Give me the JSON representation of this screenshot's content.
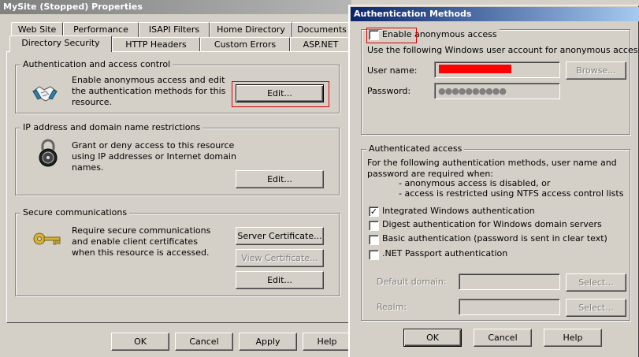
{
  "properties_window": {
    "title": "MySite (Stopped) Properties",
    "tabs_back": [
      "Web Site",
      "Performance",
      "ISAPI Filters",
      "Home Directory",
      "Documents"
    ],
    "tabs_front": [
      "Directory Security",
      "HTTP Headers",
      "Custom Errors",
      "ASP.NET"
    ],
    "active_tab": "Directory Security",
    "auth_group": {
      "label": "Authentication and access control",
      "text": "Enable anonymous access and edit the authentication methods for this resource.",
      "edit_label": "Edit..."
    },
    "ip_group": {
      "label": "IP address and domain name restrictions",
      "text": "Grant or deny access to this resource using IP addresses or Internet domain names.",
      "edit_label": "Edit..."
    },
    "secure_group": {
      "label": "Secure communications",
      "text": "Require secure communications and enable client certificates when this resource is accessed.",
      "server_cert_label": "Server Certificate...",
      "view_cert_label": "View Certificate...",
      "edit_label": "Edit..."
    },
    "buttons": {
      "ok": "OK",
      "cancel": "Cancel",
      "apply": "Apply",
      "help": "Help"
    }
  },
  "auth_dialog": {
    "title": "Authentication Methods",
    "anon_checkbox_label": "Enable anonymous access",
    "anon_checked": false,
    "anon_intro": "Use the following Windows user account for anonymous access:",
    "username_label": "User name:",
    "username_value": "",
    "browse_label": "Browse...",
    "password_label": "Password:",
    "password_value": "●●●●●●●●●●",
    "authenticated_group": {
      "label": "Authenticated access",
      "intro": "For the following authentication methods, user name and password are required when:",
      "bullet1": "- anonymous access is disabled, or",
      "bullet2": "- access is restricted using NTFS access control lists",
      "options": [
        {
          "label": "Integrated Windows authentication",
          "checked": true
        },
        {
          "label": "Digest authentication for Windows domain servers",
          "checked": false
        },
        {
          "label": "Basic authentication (password is sent in clear text)",
          "checked": false
        },
        {
          "label": ".NET Passport authentication",
          "checked": false
        }
      ],
      "default_domain_label": "Default domain:",
      "realm_label": "Realm:",
      "select_label": "Select..."
    },
    "buttons": {
      "ok": "OK",
      "cancel": "Cancel",
      "help": "Help"
    }
  },
  "icons": [
    "handshake-icon",
    "padlock-icon",
    "key-icon"
  ],
  "colors": {
    "redaction": "#ff0000",
    "highlight_box": "#e00000",
    "active_title": "#0a246a",
    "face": "#d4d0c8"
  }
}
